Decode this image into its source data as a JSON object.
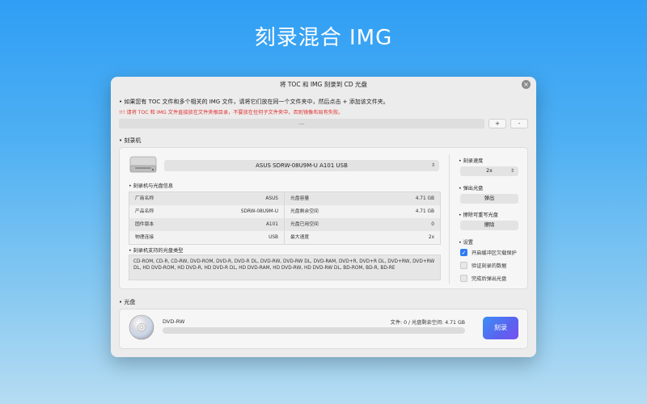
{
  "hero": {
    "title": "刻录混合 IMG"
  },
  "window": {
    "title": "将 TOC 和 IMG 刻录到 CD 光盘",
    "close_glyph": "×"
  },
  "instructions": {
    "line1": "• 如果您有 TOC 文件和多个相关的 IMG 文件，请将它们放在同一个文件夹中，然后点击 + 添加该文件夹。",
    "warning": "!!! 请将 TOC 和 IMG 文件直接放在文件夹根目录，不要放在任何子文件夹中，否则镜像布局有失败。"
  },
  "path": {
    "placeholder": "---",
    "add_label": "+",
    "remove_label": "-"
  },
  "burner": {
    "section_label": "• 刻录机",
    "drive_name": "ASUS SDRW-08U9M-U A101 USB",
    "info_label": "• 刻录机与光盘信息",
    "info_rows": [
      {
        "k1": "厂商名称",
        "v1": "ASUS",
        "k2": "光盘容量",
        "v2": "4.71 GB"
      },
      {
        "k1": "产品名称",
        "v1": "SDRW-08U9M-U",
        "k2": "光盘剩余空间",
        "v2": "4.71 GB"
      },
      {
        "k1": "固件版本",
        "v1": "A101",
        "k2": "光盘已用空间",
        "v2": "0"
      },
      {
        "k1": "物理连接",
        "v1": "USB",
        "k2": "最大速度",
        "v2": "2x"
      }
    ],
    "types_label": "• 刻录机支持的光盘类型",
    "types_text": "CD-ROM, CD-R, CD-RW, DVD-ROM, DVD-R, DVD-R DL, DVD-RW, DVD-RW DL, DVD-RAM, DVD+R, DVD+R DL, DVD+RW, DVD+RW DL, HD DVD-ROM, HD DVD-R, HD DVD-R DL, HD DVD-RAM, HD DVD-RW, HD DVD-RW DL, BD-ROM, BD-R, BD-RE"
  },
  "right_panel": {
    "speed_label": "• 刻录速度",
    "speed_value": "2x",
    "eject_label": "• 弹出光盘",
    "eject_button": "弹出",
    "erase_label": "• 擦除可重写光盘",
    "erase_button": "擦除",
    "settings_label": "• 设置",
    "options": [
      {
        "label": "开启缓冲区欠载保护",
        "checked": true
      },
      {
        "label": "验证刻录的数据",
        "checked": false
      },
      {
        "label": "完成后弹出光盘",
        "checked": false
      }
    ]
  },
  "disc": {
    "section_label": "• 光盘",
    "type": "DVD-RW",
    "space_text": "文件: 0 / 光盘剩余空间: 4.71 GB",
    "progress": 0,
    "burn_button": "刻录"
  },
  "colors": {
    "accent": "#2f7cf6",
    "warning": "#e0312f",
    "burn_gradient_start": "#3c8ef5",
    "burn_gradient_end": "#7a4ff0"
  }
}
